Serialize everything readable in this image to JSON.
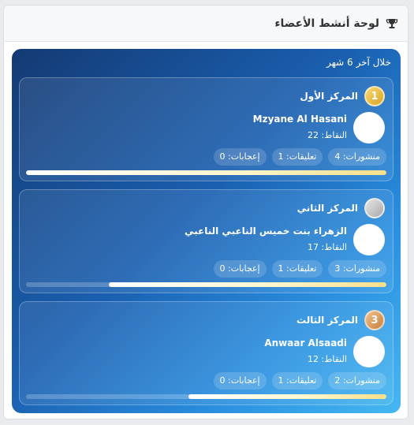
{
  "header": {
    "title": "لوحة أنشط الأعضاء",
    "icon": "trophy-icon"
  },
  "board": {
    "period": "خلال آخر 6 شهر",
    "entries": [
      {
        "rank_number": "1",
        "rank_label": "المركز الأول",
        "name": "Mzyane Al Hasani",
        "points": "النقاط: 22",
        "posts": "منشورات: 4",
        "comments": "تعليقات: 1",
        "likes": "إعجابات: 0",
        "progress": 1.0
      },
      {
        "rank_number": "",
        "rank_label": "المركز الثاني",
        "name": "الزهراء بنت خميس الناعبي الناعبي",
        "points": "النقاط: 17",
        "posts": "منشورات: 3",
        "comments": "تعليقات: 1",
        "likes": "إعجابات: 0",
        "progress": 0.77
      },
      {
        "rank_number": "3",
        "rank_label": "المركز الثالث",
        "name": "Anwaar Alsaadi",
        "points": "النقاط: 12",
        "posts": "منشورات: 2",
        "comments": "تعليقات: 1",
        "likes": "إعجابات: 0",
        "progress": 0.55
      }
    ]
  },
  "colors": {
    "gold": "#e0b232",
    "silver": "#bdbdbd",
    "bronze": "#d4914a",
    "board_start": "#143a73",
    "board_end": "#45b8f2"
  }
}
